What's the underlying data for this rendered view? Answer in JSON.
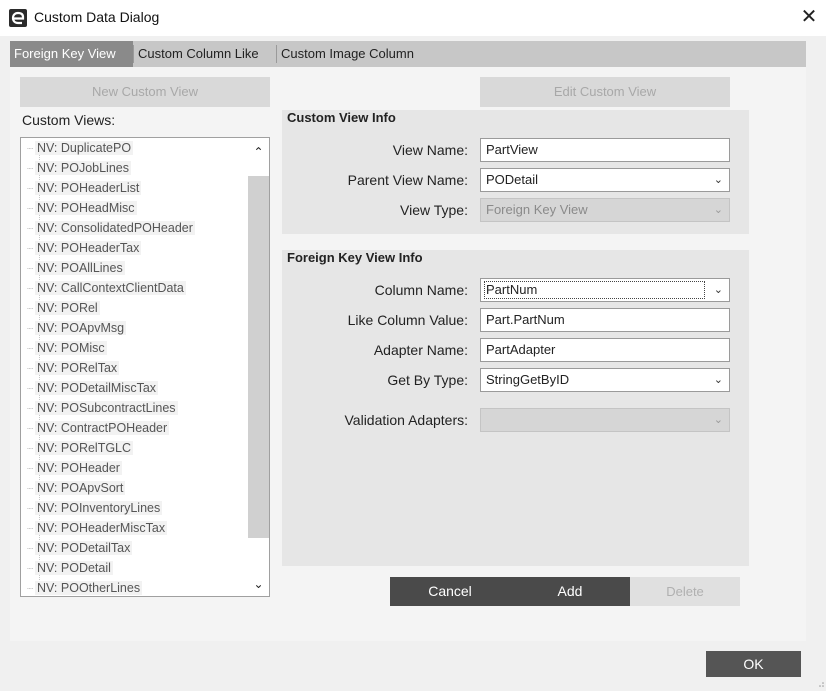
{
  "window": {
    "title": "Custom Data Dialog",
    "close_glyph": "✕",
    "icon": "app-logo-icon"
  },
  "tabs": [
    {
      "label": "Foreign Key View",
      "active": true
    },
    {
      "label": "Custom Column Like",
      "active": false
    },
    {
      "label": "Custom Image Column",
      "active": false
    }
  ],
  "left": {
    "new_button": "New Custom View",
    "list_label": "Custom Views:",
    "items": [
      "NV: DuplicatePO",
      "NV: POJobLines",
      "NV: POHeaderList",
      "NV: POHeadMisc",
      "NV: ConsolidatedPOHeader",
      "NV: POHeaderTax",
      "NV: POAllLines",
      "NV: CallContextClientData",
      "NV: PORel",
      "NV: POApvMsg",
      "NV: POMisc",
      "NV: PORelTax",
      "NV: PODetailMiscTax",
      "NV: POSubcontractLines",
      "NV: ContractPOHeader",
      "NV: PORelTGLC",
      "NV: POHeader",
      "NV: POApvSort",
      "NV: POInventoryLines",
      "NV: POHeaderMiscTax",
      "NV: PODetailTax",
      "NV: PODetail",
      "NV: POOtherLines"
    ]
  },
  "right": {
    "edit_button": "Edit Custom View",
    "custom_view_info": {
      "heading": "Custom View Info",
      "view_name_label": "View Name:",
      "view_name_value": "PartView",
      "parent_view_label": "Parent View Name:",
      "parent_view_value": "PODetail",
      "view_type_label": "View Type:",
      "view_type_value": "Foreign Key View"
    },
    "fk_view_info": {
      "heading": "Foreign Key View Info",
      "column_name_label": "Column Name:",
      "column_name_value": "PartNum",
      "like_column_label": "Like Column Value:",
      "like_column_value": "Part.PartNum",
      "adapter_name_label": "Adapter Name:",
      "adapter_name_value": "PartAdapter",
      "get_by_type_label": "Get By Type:",
      "get_by_type_value": "StringGetByID",
      "validation_adapters_label": "Validation Adapters:",
      "validation_adapters_value": ""
    }
  },
  "actions": {
    "cancel": "Cancel",
    "add": "Add",
    "delete": "Delete",
    "ok": "OK"
  },
  "icons": {
    "dropdown": "chevron-down-icon",
    "scroll_up": "scroll-up-arrow-icon",
    "scroll_down": "scroll-down-arrow-icon"
  },
  "colors": {
    "active_tab": "#8a8a8a",
    "dark_button": "#4a4a4a",
    "section_bg": "#e6e6e6"
  }
}
